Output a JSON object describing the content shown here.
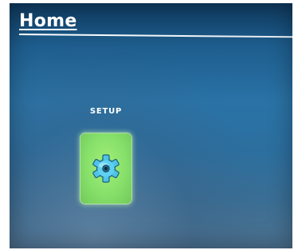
{
  "header": {
    "title": "Home"
  },
  "apps": [
    {
      "label": "SETUP",
      "icon": "gear-icon"
    }
  ],
  "colors": {
    "background_top": "#0f3a5f",
    "background_mid": "#2a73a6",
    "tile_green": "#86e06a",
    "gear_blue": "#4fc3e8"
  }
}
